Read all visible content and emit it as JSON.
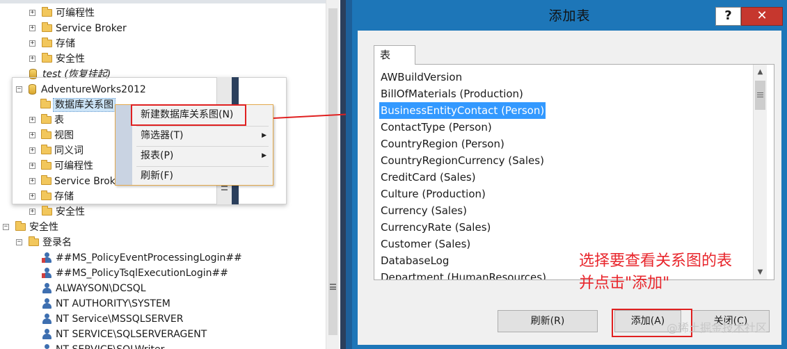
{
  "explorer": {
    "top_items": [
      {
        "label": "可编程性",
        "icon": "folder-icon"
      },
      {
        "label": "Service Broker",
        "icon": "folder-icon"
      },
      {
        "label": "存储",
        "icon": "folder-icon"
      },
      {
        "label": "安全性",
        "icon": "folder-icon"
      }
    ],
    "test_db": "test (恢复挂起)",
    "adventure_db": "AdventureWorks2012",
    "diagrams_folder": "数据库关系图",
    "adventure_children": [
      "表",
      "视图",
      "同义词",
      "可编程性",
      "Service Broker",
      "存储",
      "安全性"
    ],
    "security": "安全性",
    "logins": "登录名",
    "login_items": [
      "##MS_PolicyEventProcessingLogin##",
      "##MS_PolicyTsqlExecutionLogin##",
      "ALWAYSON\\DCSQL",
      "NT AUTHORITY\\SYSTEM",
      "NT Service\\MSSQLSERVER",
      "NT SERVICE\\SQLSERVERAGENT",
      "NT SERVICE\\SQLWriter"
    ]
  },
  "context_menu": {
    "items": [
      {
        "label": "新建数据库关系图(N)",
        "submenu": false
      },
      {
        "label": "筛选器(T)",
        "submenu": true
      },
      {
        "label": "报表(P)",
        "submenu": true
      },
      {
        "label": "刷新(F)",
        "submenu": false
      }
    ]
  },
  "dialog": {
    "title": "添加表",
    "help_label": "?",
    "close_label": "✕",
    "tab_label": "表",
    "tables": [
      "AWBuildVersion",
      "BillOfMaterials (Production)",
      "BusinessEntityContact (Person)",
      "ContactType (Person)",
      "CountryRegion (Person)",
      "CountryRegionCurrency (Sales)",
      "CreditCard (Sales)",
      "Culture (Production)",
      "Currency (Sales)",
      "CurrencyRate (Sales)",
      "Customer (Sales)",
      "DatabaseLog",
      "Department (HumanResources)"
    ],
    "selected_index": 2,
    "refresh_label": "刷新(R)",
    "add_label": "添加(A)",
    "close_dialog_label": "关闭(C)"
  },
  "annotation": {
    "line1": "选择要查看关系图的表",
    "line2": "并点击\"添加\""
  },
  "watermark": "@稀土掘金技术社区",
  "colors": {
    "dialog_frame": "#1d76b8",
    "selection": "#3399ff",
    "highlight_red": "#e02020",
    "annotation_red": "#e8262c",
    "folder": "#f2c75c"
  }
}
